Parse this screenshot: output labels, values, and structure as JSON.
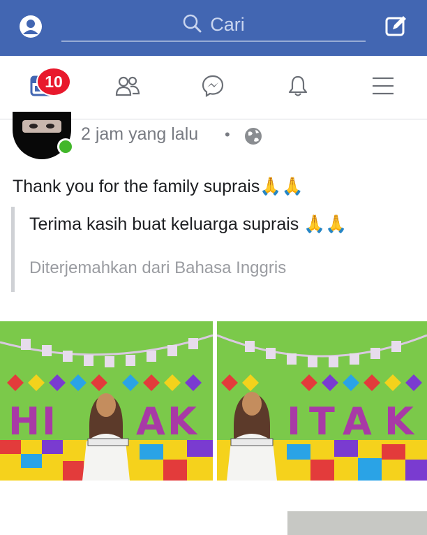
{
  "topbar": {
    "search_placeholder": "Cari",
    "bg_color": "#4266b2",
    "left_icon": "profile-icon",
    "right_icon": "compose-icon"
  },
  "nav": {
    "items": [
      {
        "icon": "news-feed-icon",
        "badge": "10"
      },
      {
        "icon": "friends-icon"
      },
      {
        "icon": "messenger-icon"
      },
      {
        "icon": "notifications-icon"
      },
      {
        "icon": "menu-icon"
      }
    ]
  },
  "post": {
    "timestamp": "2 jam yang lalu",
    "separator": "•",
    "privacy_icon": "globe-icon",
    "text": "Thank you for the family suprais🙏🙏",
    "translation": "Terima kasih buat keluarga suprais 🙏🙏",
    "translation_note": "Diterjemahkan dari Bahasa Inggris",
    "photos": [
      {
        "letters": "HIAK"
      },
      {
        "letters": "ITAK"
      }
    ]
  }
}
